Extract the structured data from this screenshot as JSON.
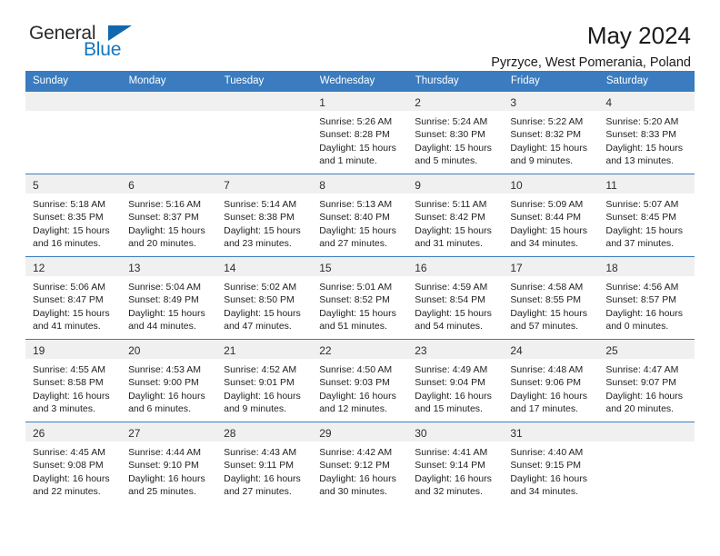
{
  "brand": {
    "name_top": "General",
    "name_bottom": "Blue",
    "triangle_color": "#1268ad",
    "blue_text_color": "#1377c0"
  },
  "header": {
    "title": "May 2024",
    "subtitle": "Pyrzyce, West Pomerania, Poland"
  },
  "theme": {
    "header_blue": "#3a7cbf",
    "daynum_gray": "#f0f0f0",
    "text": "#222222"
  },
  "weekdays": [
    "Sunday",
    "Monday",
    "Tuesday",
    "Wednesday",
    "Thursday",
    "Friday",
    "Saturday"
  ],
  "labels": {
    "sunrise": "Sunrise:",
    "sunset": "Sunset:",
    "daylight": "Daylight:"
  },
  "weeks": [
    [
      {
        "day": "",
        "blank": true
      },
      {
        "day": "",
        "blank": true
      },
      {
        "day": "",
        "blank": true
      },
      {
        "day": "1",
        "sunrise": "Sunrise: 5:26 AM",
        "sunset": "Sunset: 8:28 PM",
        "daylight": "Daylight: 15 hours and 1 minute."
      },
      {
        "day": "2",
        "sunrise": "Sunrise: 5:24 AM",
        "sunset": "Sunset: 8:30 PM",
        "daylight": "Daylight: 15 hours and 5 minutes."
      },
      {
        "day": "3",
        "sunrise": "Sunrise: 5:22 AM",
        "sunset": "Sunset: 8:32 PM",
        "daylight": "Daylight: 15 hours and 9 minutes."
      },
      {
        "day": "4",
        "sunrise": "Sunrise: 5:20 AM",
        "sunset": "Sunset: 8:33 PM",
        "daylight": "Daylight: 15 hours and 13 minutes."
      }
    ],
    [
      {
        "day": "5",
        "sunrise": "Sunrise: 5:18 AM",
        "sunset": "Sunset: 8:35 PM",
        "daylight": "Daylight: 15 hours and 16 minutes."
      },
      {
        "day": "6",
        "sunrise": "Sunrise: 5:16 AM",
        "sunset": "Sunset: 8:37 PM",
        "daylight": "Daylight: 15 hours and 20 minutes."
      },
      {
        "day": "7",
        "sunrise": "Sunrise: 5:14 AM",
        "sunset": "Sunset: 8:38 PM",
        "daylight": "Daylight: 15 hours and 23 minutes."
      },
      {
        "day": "8",
        "sunrise": "Sunrise: 5:13 AM",
        "sunset": "Sunset: 8:40 PM",
        "daylight": "Daylight: 15 hours and 27 minutes."
      },
      {
        "day": "9",
        "sunrise": "Sunrise: 5:11 AM",
        "sunset": "Sunset: 8:42 PM",
        "daylight": "Daylight: 15 hours and 31 minutes."
      },
      {
        "day": "10",
        "sunrise": "Sunrise: 5:09 AM",
        "sunset": "Sunset: 8:44 PM",
        "daylight": "Daylight: 15 hours and 34 minutes."
      },
      {
        "day": "11",
        "sunrise": "Sunrise: 5:07 AM",
        "sunset": "Sunset: 8:45 PM",
        "daylight": "Daylight: 15 hours and 37 minutes."
      }
    ],
    [
      {
        "day": "12",
        "sunrise": "Sunrise: 5:06 AM",
        "sunset": "Sunset: 8:47 PM",
        "daylight": "Daylight: 15 hours and 41 minutes."
      },
      {
        "day": "13",
        "sunrise": "Sunrise: 5:04 AM",
        "sunset": "Sunset: 8:49 PM",
        "daylight": "Daylight: 15 hours and 44 minutes."
      },
      {
        "day": "14",
        "sunrise": "Sunrise: 5:02 AM",
        "sunset": "Sunset: 8:50 PM",
        "daylight": "Daylight: 15 hours and 47 minutes."
      },
      {
        "day": "15",
        "sunrise": "Sunrise: 5:01 AM",
        "sunset": "Sunset: 8:52 PM",
        "daylight": "Daylight: 15 hours and 51 minutes."
      },
      {
        "day": "16",
        "sunrise": "Sunrise: 4:59 AM",
        "sunset": "Sunset: 8:54 PM",
        "daylight": "Daylight: 15 hours and 54 minutes."
      },
      {
        "day": "17",
        "sunrise": "Sunrise: 4:58 AM",
        "sunset": "Sunset: 8:55 PM",
        "daylight": "Daylight: 15 hours and 57 minutes."
      },
      {
        "day": "18",
        "sunrise": "Sunrise: 4:56 AM",
        "sunset": "Sunset: 8:57 PM",
        "daylight": "Daylight: 16 hours and 0 minutes."
      }
    ],
    [
      {
        "day": "19",
        "sunrise": "Sunrise: 4:55 AM",
        "sunset": "Sunset: 8:58 PM",
        "daylight": "Daylight: 16 hours and 3 minutes."
      },
      {
        "day": "20",
        "sunrise": "Sunrise: 4:53 AM",
        "sunset": "Sunset: 9:00 PM",
        "daylight": "Daylight: 16 hours and 6 minutes."
      },
      {
        "day": "21",
        "sunrise": "Sunrise: 4:52 AM",
        "sunset": "Sunset: 9:01 PM",
        "daylight": "Daylight: 16 hours and 9 minutes."
      },
      {
        "day": "22",
        "sunrise": "Sunrise: 4:50 AM",
        "sunset": "Sunset: 9:03 PM",
        "daylight": "Daylight: 16 hours and 12 minutes."
      },
      {
        "day": "23",
        "sunrise": "Sunrise: 4:49 AM",
        "sunset": "Sunset: 9:04 PM",
        "daylight": "Daylight: 16 hours and 15 minutes."
      },
      {
        "day": "24",
        "sunrise": "Sunrise: 4:48 AM",
        "sunset": "Sunset: 9:06 PM",
        "daylight": "Daylight: 16 hours and 17 minutes."
      },
      {
        "day": "25",
        "sunrise": "Sunrise: 4:47 AM",
        "sunset": "Sunset: 9:07 PM",
        "daylight": "Daylight: 16 hours and 20 minutes."
      }
    ],
    [
      {
        "day": "26",
        "sunrise": "Sunrise: 4:45 AM",
        "sunset": "Sunset: 9:08 PM",
        "daylight": "Daylight: 16 hours and 22 minutes."
      },
      {
        "day": "27",
        "sunrise": "Sunrise: 4:44 AM",
        "sunset": "Sunset: 9:10 PM",
        "daylight": "Daylight: 16 hours and 25 minutes."
      },
      {
        "day": "28",
        "sunrise": "Sunrise: 4:43 AM",
        "sunset": "Sunset: 9:11 PM",
        "daylight": "Daylight: 16 hours and 27 minutes."
      },
      {
        "day": "29",
        "sunrise": "Sunrise: 4:42 AM",
        "sunset": "Sunset: 9:12 PM",
        "daylight": "Daylight: 16 hours and 30 minutes."
      },
      {
        "day": "30",
        "sunrise": "Sunrise: 4:41 AM",
        "sunset": "Sunset: 9:14 PM",
        "daylight": "Daylight: 16 hours and 32 minutes."
      },
      {
        "day": "31",
        "sunrise": "Sunrise: 4:40 AM",
        "sunset": "Sunset: 9:15 PM",
        "daylight": "Daylight: 16 hours and 34 minutes."
      },
      {
        "day": "",
        "blank": true
      }
    ]
  ]
}
